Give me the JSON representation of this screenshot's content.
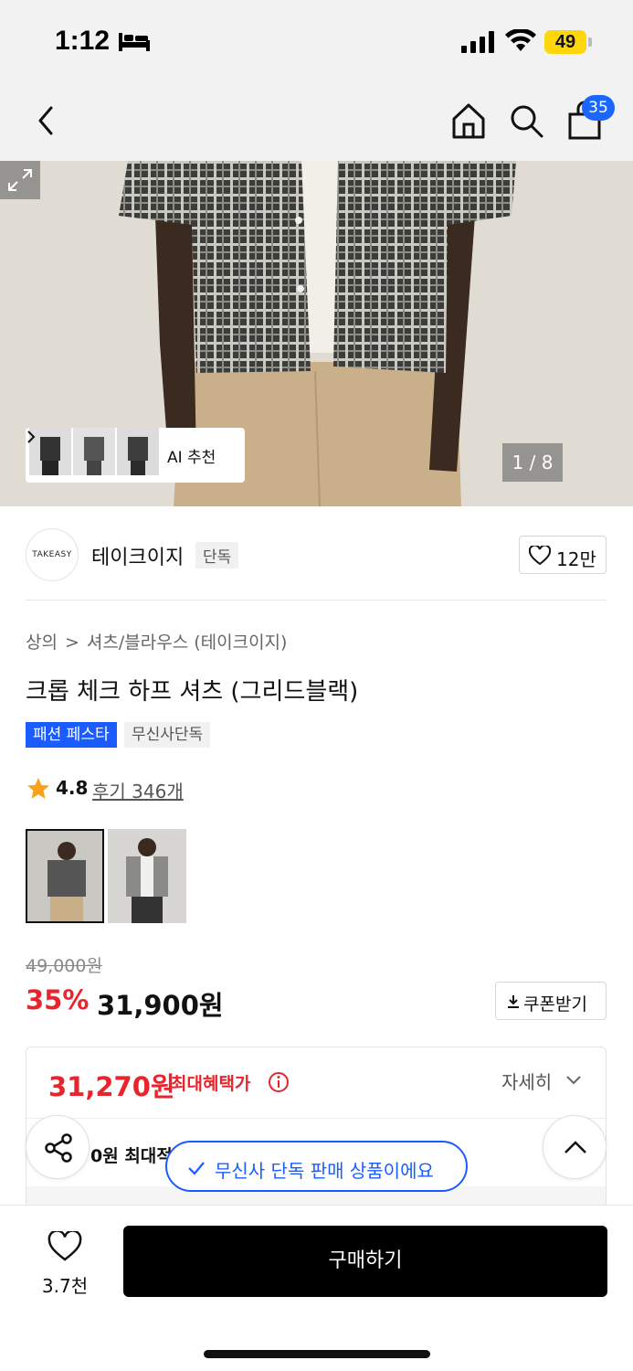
{
  "status_bar": {
    "time": "1:12",
    "battery": "49"
  },
  "nav": {
    "cart_count": "35"
  },
  "gallery": {
    "ai_recommend_label": "AI 추천",
    "counter": "1 / 8"
  },
  "brand": {
    "logo_text": "TAKEASY",
    "name": "테이크이지",
    "tag": "단독",
    "like_count": "12만"
  },
  "product": {
    "breadcrumb": [
      "상의",
      "셔츠/블라우스 (테이크이지)"
    ],
    "title": "크롭 체크 하프 셔츠 (그리드블랙)",
    "badge_primary": "패션 페스타",
    "badge_secondary": "무신사단독",
    "rating": "4.8",
    "reviews": "후기 346개",
    "original_price": "49,000원",
    "discount": "35%",
    "price": "31,900원",
    "coupon_label": "쿠폰받기"
  },
  "benefit": {
    "max_price": "31,270원",
    "max_label": "최대혜택가",
    "detail_label": "자세히",
    "row2_text": "0원 최대적"
  },
  "toast": {
    "text": "무신사 단독 판매 상품이에요"
  },
  "bottom_bar": {
    "wish_count": "3.7천",
    "buy_label": "구매하기"
  },
  "colors": {
    "accent_blue": "#1a5cff",
    "sale_red": "#e8242c",
    "battery_yellow": "#ffd60a"
  },
  "icons": [
    "back-icon",
    "home-icon",
    "search-icon",
    "bag-icon",
    "chevron-right-icon",
    "expand-icon",
    "heart-icon",
    "star-icon",
    "download-icon",
    "info-icon",
    "chevron-down-icon",
    "share-icon",
    "chevron-up-icon",
    "check-icon"
  ]
}
